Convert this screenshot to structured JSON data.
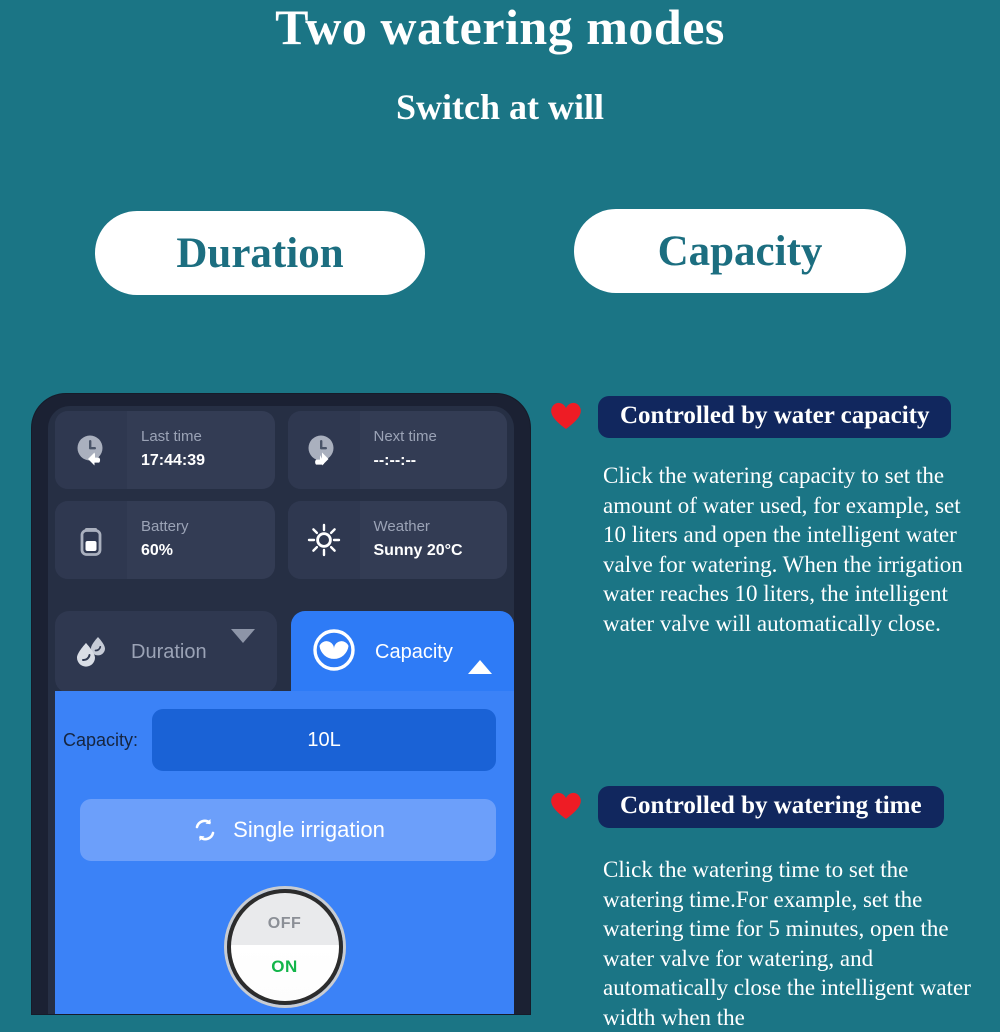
{
  "header": {
    "title": "Two watering modes",
    "subtitle": "Switch at will"
  },
  "mode_buttons": [
    {
      "label": "Duration"
    },
    {
      "label": "Capacity"
    }
  ],
  "phone_app": {
    "info_cards": [
      {
        "icon": "clock-back-icon",
        "label": "Last time",
        "value": "17:44:39"
      },
      {
        "icon": "clock-forward-icon",
        "label": "Next time",
        "value": "--:--:--"
      },
      {
        "icon": "battery-icon",
        "label": "Battery",
        "value": "60%"
      },
      {
        "icon": "sun-icon",
        "label": "Weather",
        "value": "Sunny 20°C"
      }
    ],
    "tabs": [
      {
        "label": "Duration",
        "icon": "water-drops-icon",
        "caret": "chevron-down-icon",
        "active": false
      },
      {
        "label": "Capacity",
        "icon": "water-level-circle-icon",
        "caret": "chevron-up-icon",
        "active": true
      }
    ],
    "capacity_panel": {
      "field_label": "Capacity:",
      "field_value": "10L",
      "irrigation_button": {
        "label": "Single irrigation",
        "icon": "loop-icon"
      },
      "power_knob": {
        "off_label": "OFF",
        "on_label": "ON"
      }
    }
  },
  "callouts": [
    {
      "icon": "heart-icon",
      "banner": "Controlled by water capacity",
      "body": "Click the watering capacity to set the amount of water used, for example, set 10 liters and open the intelligent water valve for watering. When the irrigation water reaches 10 liters, the intelligent water valve will automatically close."
    },
    {
      "icon": "heart-icon",
      "banner": "Controlled by watering time",
      "body": "Click the watering time to set the watering time.For example, set the watering time for 5 minutes, open the water valve for watering, and automatically close the intelligent water width when the"
    }
  ],
  "colors": {
    "background_teal": "#1b7585",
    "pill_text_teal": "#1c6e80",
    "banner_navy": "#11275e",
    "heart_red": "#ee1c25",
    "accent_blue": "#3b82f7",
    "input_blue": "#1a62d6",
    "phone_body": "#1b2133",
    "screen_dark": "#262f44",
    "card_dark": "#333c54",
    "on_green": "#13b54a"
  }
}
